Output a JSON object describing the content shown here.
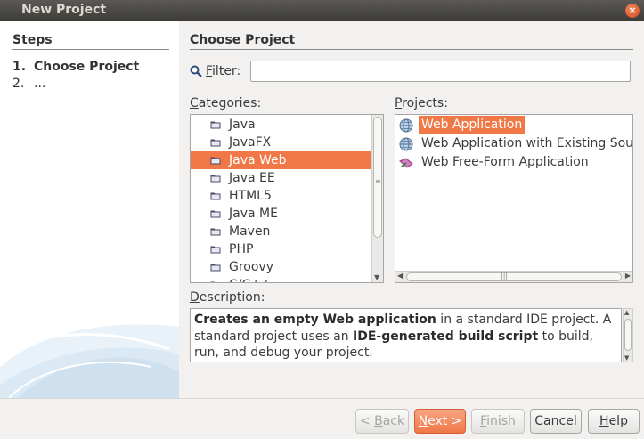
{
  "window": {
    "title": "New Project",
    "close_glyph": "×"
  },
  "steps": {
    "heading": "Steps",
    "items": [
      {
        "num": "1.",
        "label": "Choose Project"
      },
      {
        "num": "2.",
        "label": "..."
      }
    ]
  },
  "main": {
    "heading": "Choose Project",
    "filter": {
      "label_accel": "F",
      "label_rest": "ilter:",
      "value": ""
    },
    "categories": {
      "label_accel": "C",
      "label_rest": "ategories:",
      "items": [
        "Java",
        "JavaFX",
        "Java Web",
        "Java EE",
        "HTML5",
        "Java ME",
        "Maven",
        "PHP",
        "Groovy",
        "C/C++"
      ],
      "selected_index": 2
    },
    "projects": {
      "label_accel": "P",
      "label_rest": "rojects:",
      "items": [
        {
          "label": "Web Application",
          "icon": "globe-icon"
        },
        {
          "label": "Web Application with Existing Sources",
          "icon": "globe-icon"
        },
        {
          "label": "Web Free-Form Application",
          "icon": "freeform-icon"
        }
      ],
      "selected_index": 0
    },
    "description": {
      "label_accel": "D",
      "label_rest": "escription:",
      "b1": "Creates an empty Web application",
      "t1": " in a standard IDE project. A standard project uses an ",
      "b2": "IDE-generated build script",
      "t2": " to build, run, and debug your project."
    }
  },
  "buttons": {
    "back": {
      "prefix": "< ",
      "accel": "B",
      "rest": "ack"
    },
    "next": {
      "accel": "N",
      "rest": "ext >"
    },
    "finish": {
      "accel": "F",
      "rest": "inish"
    },
    "cancel": {
      "label": "Cancel"
    },
    "help": {
      "accel": "H",
      "rest": "elp"
    }
  },
  "colors": {
    "selection": "#f07746",
    "titlebar": "#3d3c38",
    "window_bg": "#f2f1f0"
  }
}
